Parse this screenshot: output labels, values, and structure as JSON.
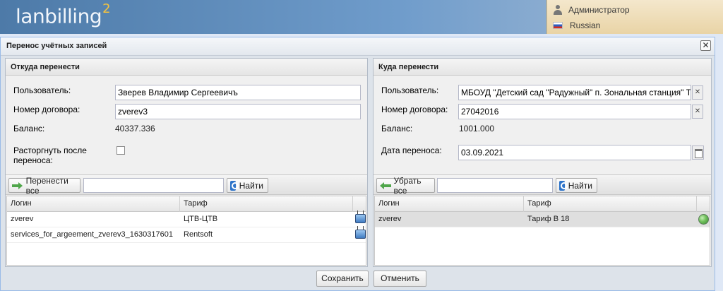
{
  "header": {
    "logo_text": "lanbilling",
    "logo_sup": "2",
    "user_name": "Администратор",
    "language": "Russian"
  },
  "window": {
    "title": "Перенос учётных записей"
  },
  "left_panel": {
    "title": "Откуда перенести",
    "user_label": "Пользователь:",
    "user_value": "Зверев Владимир Сергеевичъ",
    "contract_label": "Номер договора:",
    "contract_value": "zverev3",
    "balance_label": "Баланс:",
    "balance_value": "40337.336",
    "terminate_label_1": "Расторгнуть после",
    "terminate_label_2": "переноса:",
    "terminate_checked": false,
    "move_all_button": "Перенести все",
    "search_value": "",
    "find_button": "Найти",
    "grid": {
      "columns": [
        "Логин",
        "Тариф"
      ],
      "rows": [
        {
          "login": "zverev",
          "tariff": "ЦТВ-ЦТВ",
          "icon": "tv-icon"
        },
        {
          "login": "services_for_argeement_zverev3_1630317601",
          "tariff": "Rentsoft",
          "icon": "tv-icon"
        }
      ]
    }
  },
  "right_panel": {
    "title": "Куда перенести",
    "user_label": "Пользователь:",
    "user_value": "МБОУД \"Детский сад \"Радужный\" п. Зональная станция\" Т",
    "contract_label": "Номер договора:",
    "contract_value": "27042016",
    "balance_label": "Баланс:",
    "balance_value": "1001.000",
    "date_label": "Дата переноса:",
    "date_value": "03.09.2021",
    "remove_all_button": "Убрать все",
    "search_value": "",
    "find_button": "Найти",
    "grid": {
      "columns": [
        "Логин",
        "Тариф"
      ],
      "rows": [
        {
          "login": "zverev",
          "tariff": "Тариф В 18",
          "icon": "globe-icon"
        }
      ]
    }
  },
  "footer": {
    "save_button": "Сохранить",
    "cancel_button": "Отменить"
  }
}
